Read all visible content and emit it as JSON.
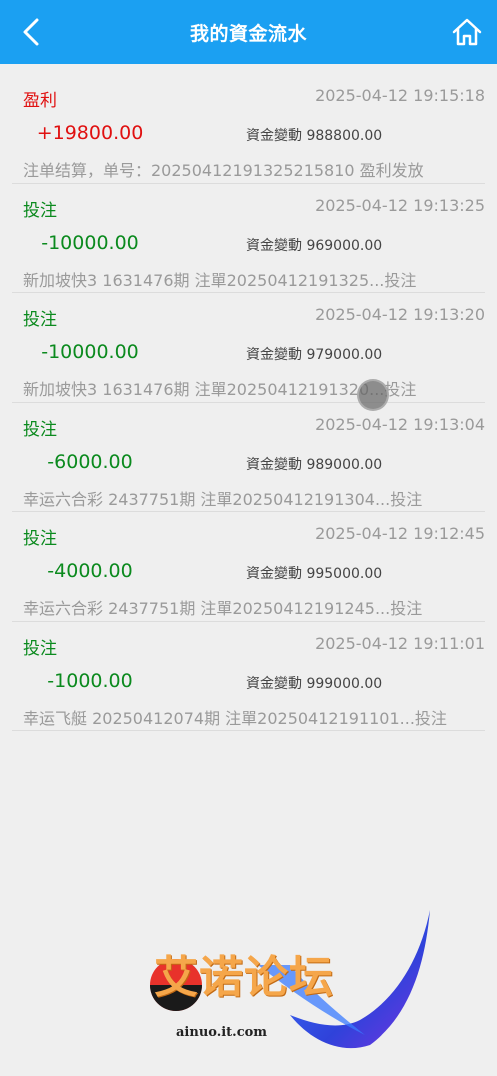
{
  "header": {
    "title": "我的資金流水",
    "back_icon": "chevron-left-icon",
    "home_icon": "home-icon"
  },
  "records": [
    {
      "type": "盈利",
      "time": "2025-04-12 19:15:18",
      "amount": "+19800.00",
      "balance": "資金變動 988800.00",
      "desc": "注单结算，单号：20250412191325215810 盈利发放",
      "color": "#e01010"
    },
    {
      "type": "投注",
      "time": "2025-04-12 19:13:25",
      "amount": "-10000.00",
      "balance": "資金變動 969000.00",
      "desc": "新加坡快3 1631476期 注單20250412191325...投注",
      "color": "#0b8a1e"
    },
    {
      "type": "投注",
      "time": "2025-04-12 19:13:20",
      "amount": "-10000.00",
      "balance": "資金變動 979000.00",
      "desc": "新加坡快3 1631476期 注單20250412191320...投注",
      "color": "#0b8a1e"
    },
    {
      "type": "投注",
      "time": "2025-04-12 19:13:04",
      "amount": "-6000.00",
      "balance": "資金變動 989000.00",
      "desc": "幸运六合彩 2437751期 注單20250412191304...投注",
      "color": "#0b8a1e"
    },
    {
      "type": "投注",
      "time": "2025-04-12 19:12:45",
      "amount": "-4000.00",
      "balance": "資金變動 995000.00",
      "desc": "幸运六合彩 2437751期 注單20250412191245...投注",
      "color": "#0b8a1e"
    },
    {
      "type": "投注",
      "time": "2025-04-12 19:11:01",
      "amount": "-1000.00",
      "balance": "資金變動 999000.00",
      "desc": "幸运飞艇 20250412074期 注單20250412191101...投注",
      "color": "#0b8a1e"
    }
  ],
  "watermark": {
    "name": "艾诺论坛",
    "site": "ainuo.it.com"
  }
}
